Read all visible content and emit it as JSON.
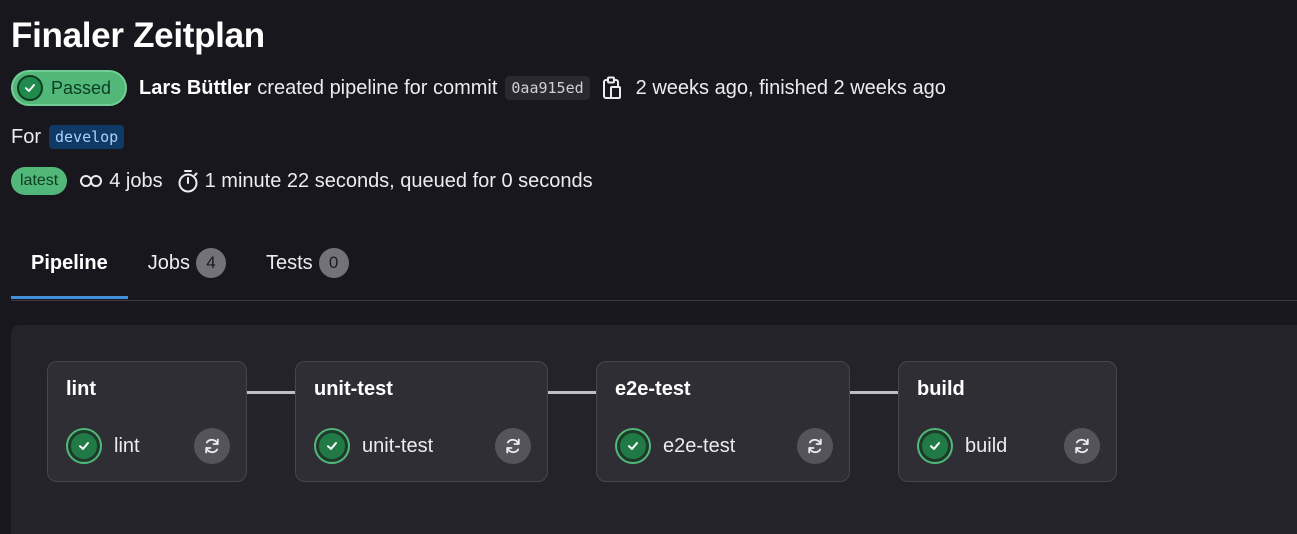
{
  "page": {
    "title": "Finaler Zeitplan"
  },
  "status": {
    "label": "Passed",
    "color": "#52b87a"
  },
  "pipeline_info": {
    "author": "Lars Büttler",
    "created_text": "created pipeline for commit",
    "commit_sha": "0aa915ed",
    "copy_icon": "clipboard-icon",
    "time_text": "2 weeks ago, finished 2 weeks ago"
  },
  "ref": {
    "prefix": "For",
    "branch": "develop"
  },
  "meta": {
    "latest_label": "latest",
    "jobs_icon": "pipeline-link-icon",
    "jobs_text": "4 jobs",
    "duration_icon": "stopwatch-icon",
    "duration_text": "1 minute 22 seconds, queued for 0 seconds"
  },
  "tabs": [
    {
      "label": "Pipeline",
      "count": null,
      "active": true
    },
    {
      "label": "Jobs",
      "count": "4",
      "active": false
    },
    {
      "label": "Tests",
      "count": "0",
      "active": false
    }
  ],
  "stages": [
    {
      "name": "lint",
      "jobs": [
        {
          "name": "lint",
          "status": "success"
        }
      ]
    },
    {
      "name": "unit-test",
      "jobs": [
        {
          "name": "unit-test",
          "status": "success"
        }
      ]
    },
    {
      "name": "e2e-test",
      "jobs": [
        {
          "name": "e2e-test",
          "status": "success"
        }
      ]
    },
    {
      "name": "build",
      "jobs": [
        {
          "name": "build",
          "status": "success"
        }
      ]
    }
  ],
  "colors": {
    "accent": "#428fdc",
    "success": "#52b87a",
    "background": "#18171d"
  }
}
